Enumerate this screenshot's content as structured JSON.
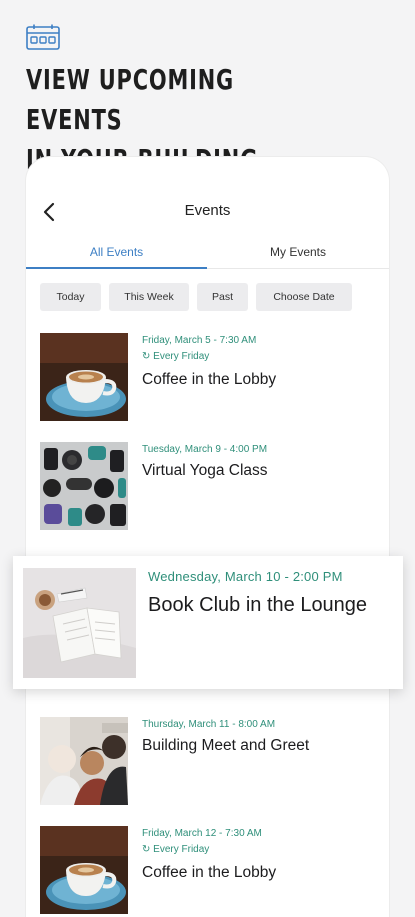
{
  "headline": {
    "line1": "VIEW UPCOMING EVENTS",
    "line2": "IN YOUR BUILDING"
  },
  "header": {
    "title": "Events"
  },
  "tabs": [
    {
      "label": "All Events",
      "active": true
    },
    {
      "label": "My Events",
      "active": false
    }
  ],
  "filters": [
    "Today",
    "This Week",
    "Past",
    "Choose Date"
  ],
  "events": [
    {
      "date": "Friday, March 5 - 7:30 AM",
      "recurrence": "Every Friday",
      "title": "Coffee in the Lobby",
      "image": "coffee-cup"
    },
    {
      "date": "Tuesday, March 9 - 4:00 PM",
      "title": "Virtual Yoga Class",
      "image": "yoga-equipment"
    },
    {
      "date": "Wednesday, March 10 - 2:00 PM",
      "title": "Book Club in the Lounge",
      "image": "open-book"
    },
    {
      "date": "Thursday, March 11 - 8:00 AM",
      "title": "Building Meet and Greet",
      "image": "people-group"
    },
    {
      "date": "Friday, March 12 - 7:30 AM",
      "recurrence": "Every Friday",
      "title": "Coffee in the Lobby",
      "image": "coffee-cup"
    }
  ],
  "colors": {
    "accent": "#3d7fc4",
    "date_green": "#2f8f7a",
    "chip_bg": "#ececee",
    "background": "#f4f4f5"
  }
}
